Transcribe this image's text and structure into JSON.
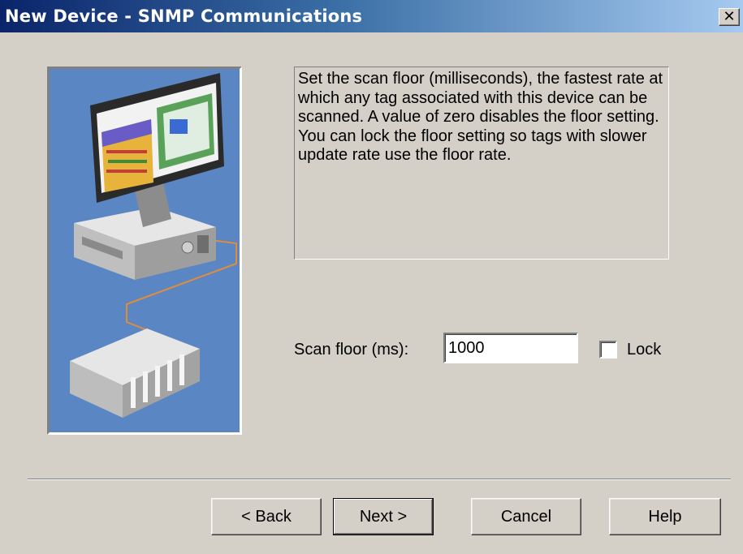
{
  "window": {
    "title": "New Device - SNMP Communications",
    "close_glyph": "✕"
  },
  "illustration": {
    "icon": "computer-plc-network-illustration"
  },
  "description": "Set the scan floor (milliseconds), the fastest rate at which any tag associated with this device can be scanned. A value of zero disables the floor setting.  You can lock the floor setting so tags with slower update rate use the floor rate.",
  "scan_floor": {
    "label": "Scan floor (ms):",
    "value": "1000"
  },
  "lock": {
    "label": "Lock",
    "checked": false
  },
  "buttons": {
    "back": "< Back",
    "next": "Next >",
    "cancel": "Cancel",
    "help": "Help"
  },
  "colors": {
    "face": "#d4d0c8",
    "title_start": "#0a246a",
    "title_end": "#a6caf0",
    "illustration_bg": "#5a86c4"
  }
}
